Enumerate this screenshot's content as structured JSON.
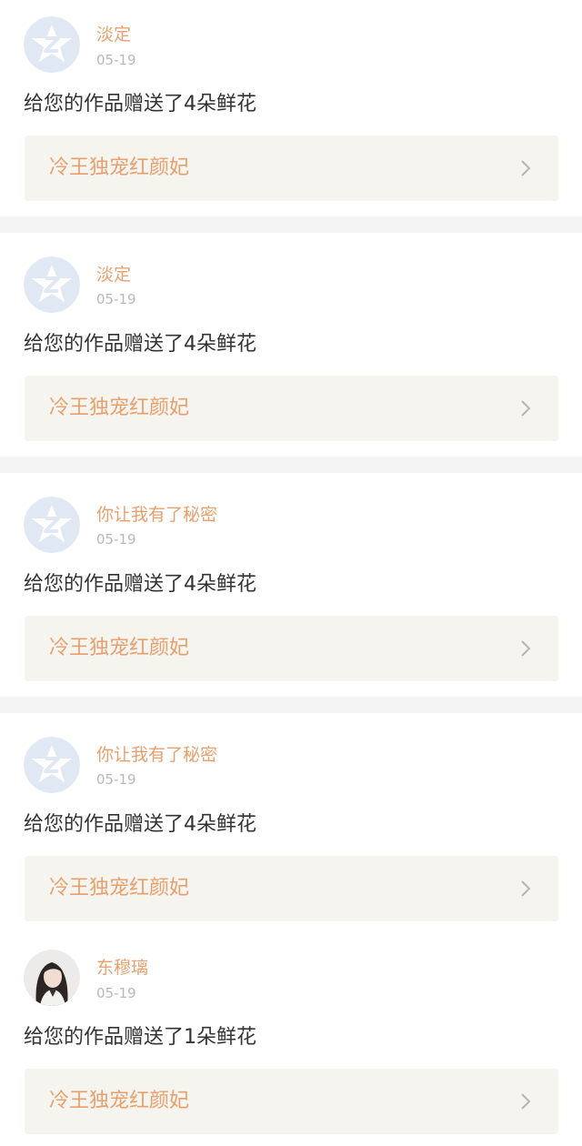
{
  "notifications": [
    {
      "username": "淡定",
      "date": "05-19",
      "message": "给您的作品赠送了4朵鲜花",
      "work_title": "冷王独宠红颜妃",
      "avatar_icon": "default-star-avatar-icon"
    },
    {
      "username": "淡定",
      "date": "05-19",
      "message": "给您的作品赠送了4朵鲜花",
      "work_title": "冷王独宠红颜妃",
      "avatar_icon": "default-star-avatar-icon"
    },
    {
      "username": "你让我有了秘密",
      "date": "05-19",
      "message": "给您的作品赠送了4朵鲜花",
      "work_title": "冷王独宠红颜妃",
      "avatar_icon": "default-star-avatar-icon"
    },
    {
      "username": "你让我有了秘密",
      "date": "05-19",
      "message": "给您的作品赠送了4朵鲜花",
      "work_title": "冷王独宠红颜妃",
      "avatar_icon": "default-star-avatar-icon"
    },
    {
      "username": "东穆璃",
      "date": "05-19",
      "message": "给您的作品赠送了1朵鲜花",
      "work_title": "冷王独宠红颜妃",
      "avatar_icon": "user-photo-avatar-icon"
    }
  ],
  "colors": {
    "accent": "#e8a06e",
    "date_gray": "#b9b9b9",
    "message_text": "#333333",
    "link_background": "#f5f4ee",
    "divider": "#f5f4f4",
    "default_avatar_bg": "#dfe8f3"
  },
  "icons": {
    "chevron": "chevron-right-icon"
  }
}
